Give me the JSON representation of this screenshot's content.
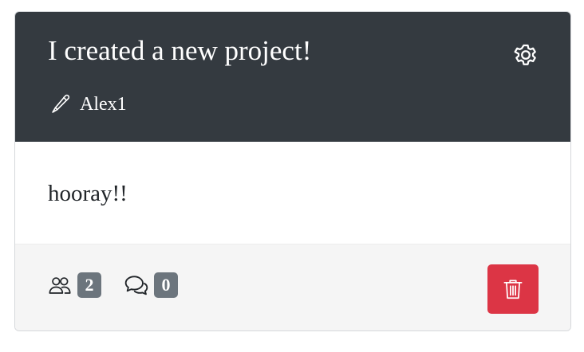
{
  "post": {
    "title": "I created a new project!",
    "author": "Alex1",
    "body": "hooray!!",
    "members_count": "2",
    "comments_count": "0"
  },
  "icons": {
    "settings": "gear-icon",
    "author": "pencil-icon",
    "members": "people-icon",
    "comments": "chat-bubbles-icon",
    "delete": "trash-icon"
  },
  "colors": {
    "header_bg": "#343a40",
    "badge_bg": "#6c757d",
    "delete_bg": "#dc3545",
    "footer_bg": "#f5f5f5"
  }
}
